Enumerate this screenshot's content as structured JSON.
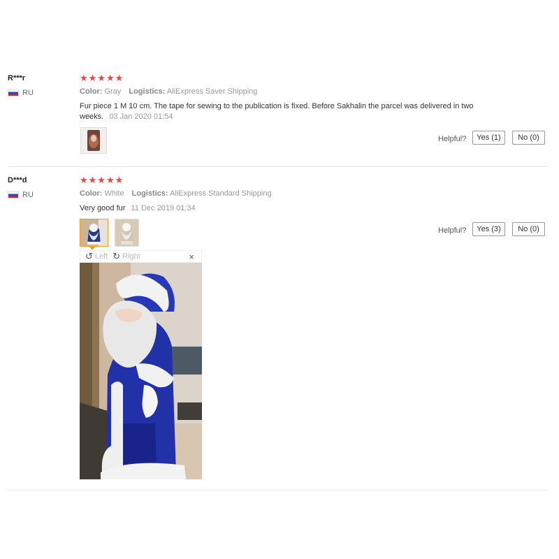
{
  "reviews": [
    {
      "user": "R***r",
      "country": "RU",
      "stars": "★★★★★",
      "color_key": "Color:",
      "color_val": "Gray",
      "logistics_key": "Logistics:",
      "logistics_val": "AliExpress Saver Shipping",
      "text": "Fur piece 1 M 10 cm. The tape for sewing to the publication is fixed. Before Sakhalin the parcel was delivered in two weeks.",
      "date": "03 Jan 2020 01:54",
      "helpful_label": "Helpful?",
      "yes_label": "Yes (1)",
      "no_label": "No (0)"
    },
    {
      "user": "D***d",
      "country": "RU",
      "stars": "★★★★★",
      "color_key": "Color:",
      "color_val": "White",
      "logistics_key": "Logistics:",
      "logistics_val": "AliExpress Standard Shipping",
      "text": "Very good fur",
      "date": "11 Dec 2019 01:34",
      "helpful_label": "Helpful?",
      "yes_label": "Yes (3)",
      "no_label": "No (0)"
    }
  ],
  "viewer": {
    "rotate_left_label": "Left",
    "rotate_right_label": "Right",
    "close_symbol": "×",
    "rotate_left_icon": "rotate-left-icon",
    "rotate_right_icon": "rotate-right-icon"
  },
  "colors": {
    "star": "#e84545",
    "selected_thumb_border": "#f39a2b"
  }
}
